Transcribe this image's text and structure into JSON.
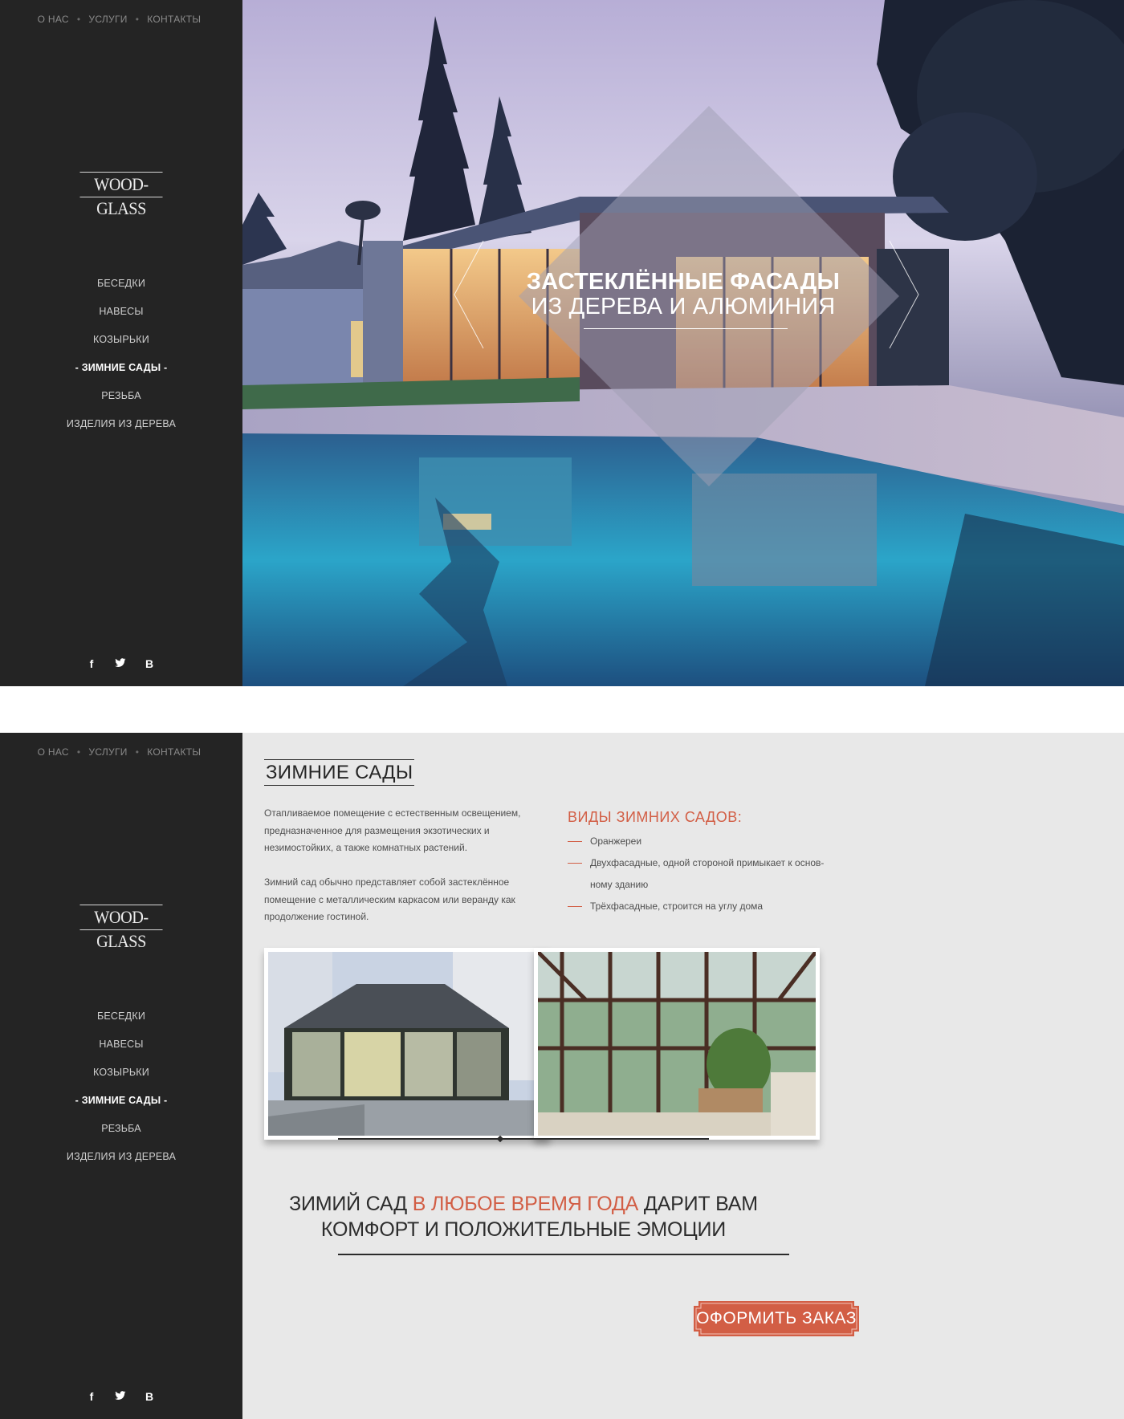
{
  "nav": {
    "about": "О НАС",
    "services": "УСЛУГИ",
    "contacts": "КОНТАКТЫ"
  },
  "brand": {
    "logo": "WOOD-GLASS"
  },
  "menu": {
    "items": [
      {
        "label": "БЕСЕДКИ",
        "active": false
      },
      {
        "label": "НАВЕСЫ",
        "active": false
      },
      {
        "label": "КОЗЫРЬКИ",
        "active": false
      },
      {
        "label": "- ЗИМНИЕ САДЫ -",
        "active": true
      },
      {
        "label": "РЕЗЬБА",
        "active": false
      },
      {
        "label": "ИЗДЕЛИЯ ИЗ ДЕРЕВА",
        "active": false
      }
    ]
  },
  "social": {
    "facebook": "f",
    "twitter": "🐦",
    "vk": "B"
  },
  "hero": {
    "line1": "ЗАСТЕКЛЁННЫЕ ФАСАДЫ",
    "line2": "ИЗ ДЕРЕВА И АЛЮМИНИЯ"
  },
  "page": {
    "title": "ЗИМНИЕ САДЫ",
    "para1": "Отапливаемое помещение с естественным освещением, предназначенное для размещения экзотических и незимостойких, а также комнатных растений.",
    "para2": "Зимний сад обычно представляет собой застеклённое помещение с металлическим каркасом или веранду как продолжение гостиной.",
    "types_title": "ВИДЫ ЗИМНИХ САДОВ:",
    "types": [
      "Оранжереи",
      "Двухфасадные, одной стороной примыкает к основ-ному зданию",
      "Трёхфасадные, строится на углу дома"
    ],
    "quote_part1": "ЗИМИЙ САД ",
    "quote_accent": "В ЛЮБОЕ ВРЕМЯ ГОДА",
    "quote_part2": " ДАРИТ ВАМ",
    "quote_line2": "КОМФОРТ И ПОЛОЖИТЕЛЬНЫЕ ЭМОЦИИ",
    "order_button": "ОФОРМИТЬ ЗАКАЗ"
  },
  "colors": {
    "sidebar": "#242424",
    "accent": "#d25e45",
    "content_bg": "#e8e8e8"
  }
}
